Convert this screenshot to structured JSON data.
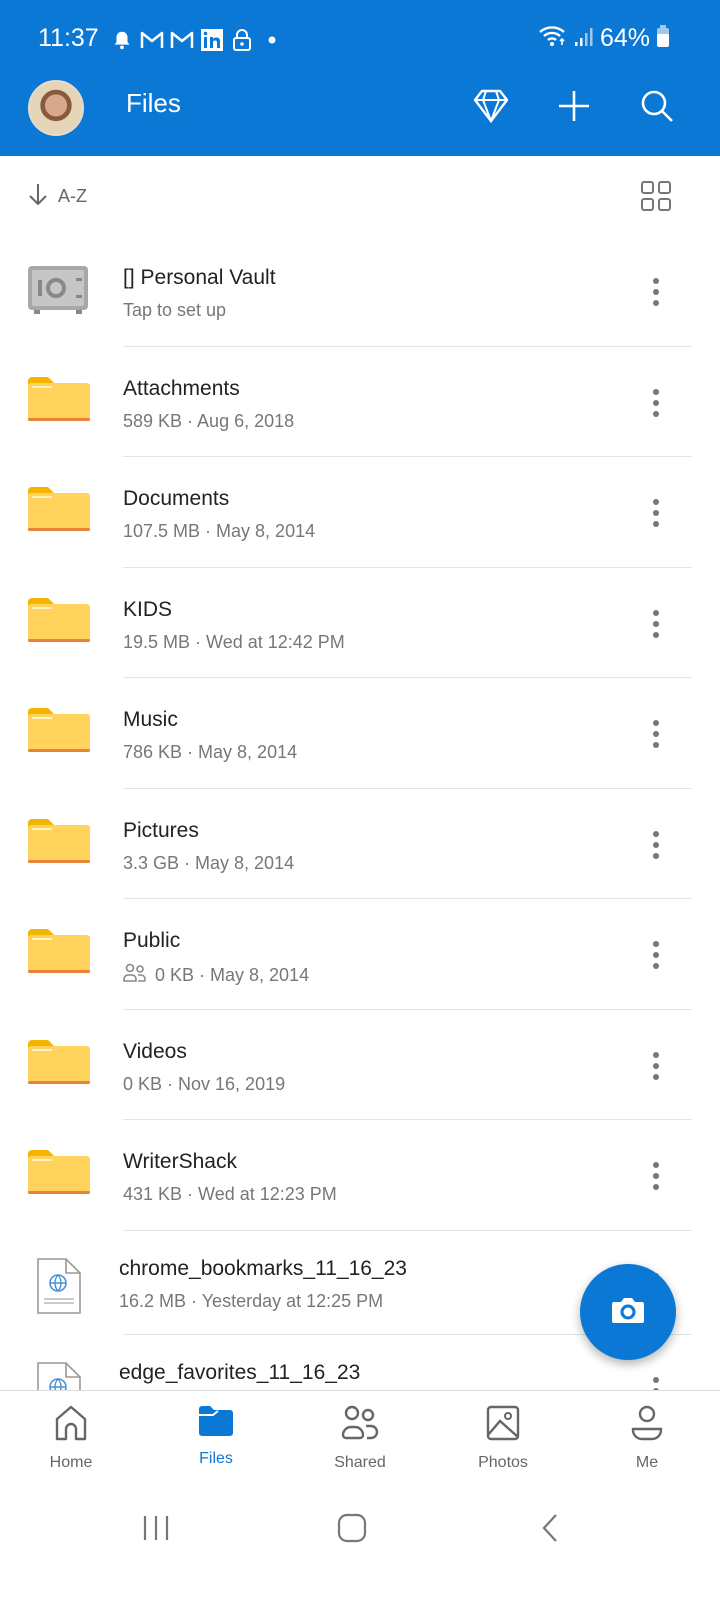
{
  "status_bar": {
    "time": "11:37",
    "notification_icons": [
      "bell-icon",
      "gmail-icon",
      "gmail-icon",
      "linkedin-icon",
      "lock-icon",
      "dot-icon"
    ],
    "battery_percent": "64%",
    "signal_icons": [
      "wifi-icon",
      "cellular-signal-icon",
      "battery-icon"
    ]
  },
  "header": {
    "title": "Files",
    "actions": [
      "premium-diamond",
      "add",
      "search"
    ],
    "colors": {
      "brand": "#0b78d6"
    }
  },
  "sortbar": {
    "sort_label": "A-Z",
    "sort_direction": "descending-arrow",
    "view_toggle": "grid-view"
  },
  "items": [
    {
      "type": "vault",
      "name": "[] Personal Vault",
      "meta": "Tap to set up"
    },
    {
      "type": "folder",
      "name": "Attachments",
      "meta": "589 KB · Aug 6, 2018"
    },
    {
      "type": "folder",
      "name": "Documents",
      "meta": "107.5 MB · May 8, 2014"
    },
    {
      "type": "folder",
      "name": "KIDS",
      "meta": "19.5 MB · Wed at 12:42 PM"
    },
    {
      "type": "folder",
      "name": "Music",
      "meta": "786 KB · May 8, 2014"
    },
    {
      "type": "folder",
      "name": "Pictures",
      "meta": "3.3 GB · May 8, 2014"
    },
    {
      "type": "folder",
      "name": "Public",
      "meta": "0 KB · May 8, 2014",
      "shared": true
    },
    {
      "type": "folder",
      "name": "Videos",
      "meta": "0 KB · Nov 16, 2019"
    },
    {
      "type": "folder",
      "name": "WriterShack",
      "meta": "431 KB · Wed at 12:23 PM"
    },
    {
      "type": "file",
      "name": "chrome_bookmarks_11_16_23",
      "meta": "16.2 MB · Yesterday at 12:25 PM"
    },
    {
      "type": "file",
      "name": "edge_favorites_11_16_23",
      "meta": ""
    }
  ],
  "fab": {
    "icon": "camera-icon"
  },
  "bottom_nav": [
    {
      "label": "Home",
      "active": false
    },
    {
      "label": "Files",
      "active": true
    },
    {
      "label": "Shared",
      "active": false
    },
    {
      "label": "Photos",
      "active": false
    },
    {
      "label": "Me",
      "active": false
    }
  ]
}
